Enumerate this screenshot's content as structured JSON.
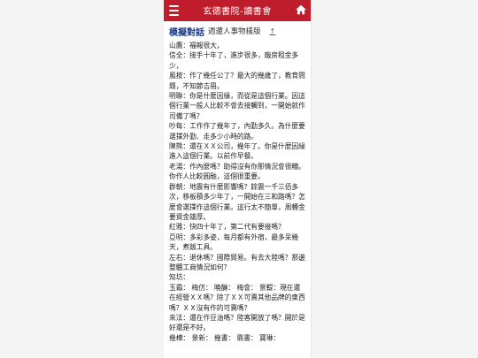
{
  "header": {
    "title": "玄德書院-讀書會"
  },
  "page": {
    "heading": "模擬對話",
    "subheading": "週遭人事物樣版",
    "up_link": "↑"
  },
  "dialogue": [
    "山鷹：福報很大，",
    "信全：接手十年了，進步很多，廠房租金多少，",
    "風按：作了幾任公了？最大的幾歲了，教育問題，不知節吉冊。",
    "明聯：你是什麼因緣，而從是這個行業。因這個行業一般人比較不會去接觸到，一開始就作司備了嗎？",
    "吵每：工作作了幾年了，內勤多久。為什麼要選擇外勤、走多少小時的路。",
    "陳熊：還在ＸＸ公司，幾年了。你是什麼因緣進入這個行業。以前作早餐。",
    "老湯：作內麼嗎？助得沒有你那情況會很糟。你作人比較圓融，這個很重要。",
    "群朝：地震有什麼影響嗎？餘震一千三佰多次，移板積多少年了，一開始在三和路嗎？怎麼會選擇作這個行業。這行太不簡單，周轉金要資金雄厚。",
    "紅雅：快四十年了，第二代有要接嗎？",
    "亞明：多彩多姿，每月都有外宿，最多呆幾天，煮飯工具。",
    "左右：退休嗎？國際貿易。有去大陸嗎？那邊整體工商情況如何？",
    "知坊：",
    "玉霜： 梅仿： 曉醂： 梅會： 景鞮：現在還在經營ＸＸ嗎？除了ＸＸ可賣其他品牌的東西嗎？ＸＸ沒有作的可賣嗎？",
    "來法：還在作豆油嗎？陸客開放了嗎？開於是好還是不好。",
    "幾樺： 景新： 幾書： 鼎書： 寶琳："
  ]
}
